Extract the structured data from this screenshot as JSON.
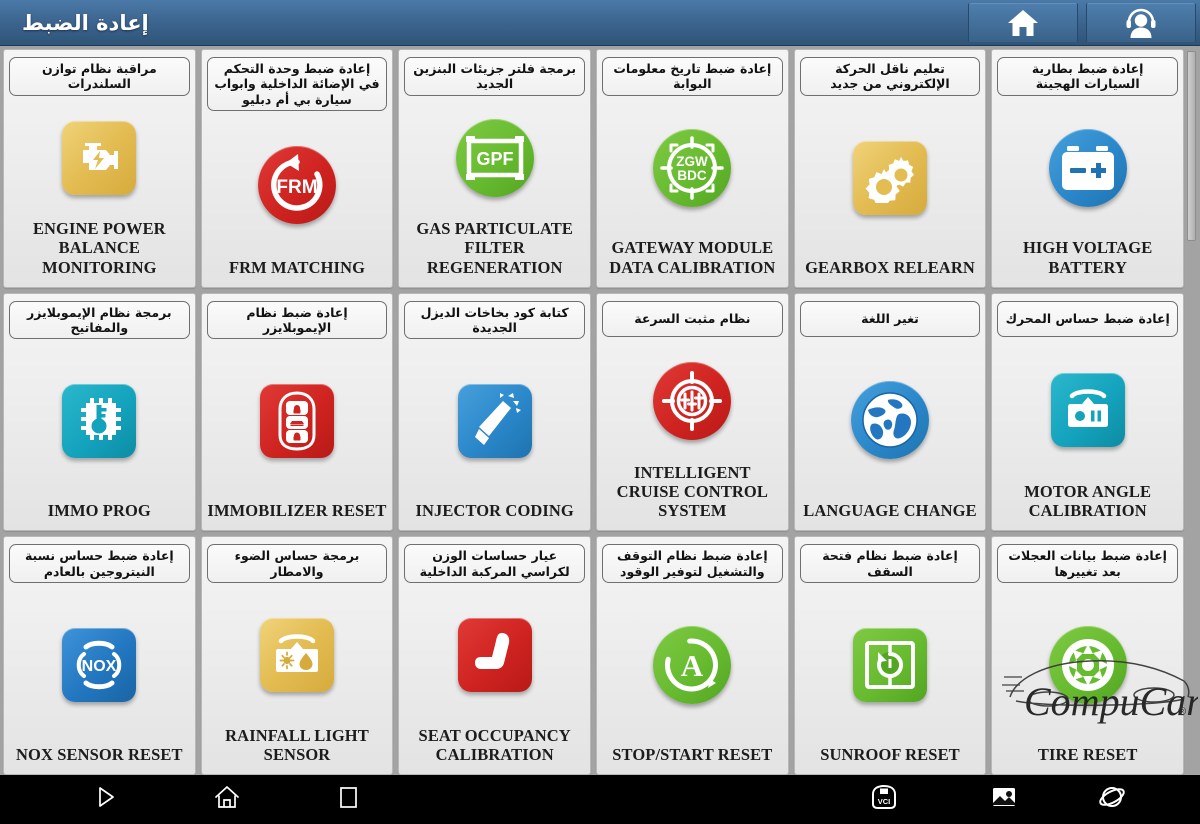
{
  "header": {
    "title": "إعادة الضبط",
    "buttons": [
      {
        "name": "home-button",
        "icon": "home-icon"
      },
      {
        "name": "support-button",
        "icon": "headset-person-icon"
      }
    ]
  },
  "grid": {
    "columns": 6,
    "rows": 3,
    "tiles": [
      {
        "arabic": "مراقبة نظام توازن السلندرات",
        "label": "ENGINE POWER BALANCE MONITORING",
        "icon": "engine-check-icon",
        "shape": "square",
        "color": "#e3bc52"
      },
      {
        "arabic": "إعادة ضبط وحدة التحكم في الإضائة الداخلية وابواب سيارة بي أم دبليو",
        "label": "FRM MATCHING",
        "icon": "frm-refresh-icon",
        "shape": "circle",
        "color": "#cf2320"
      },
      {
        "arabic": "برمجة فلتر جزيئات البنزين الجديد",
        "label": "GAS PARTICULATE FILTER REGENERATION",
        "icon": "gpf-filter-icon",
        "shape": "circle",
        "color": "#67bb2f"
      },
      {
        "arabic": "إعادة ضبط تاريخ معلومات البوابة",
        "label": "GATEWAY MODULE DATA CALIBRATION",
        "icon": "zgw-bdc-target-icon",
        "shape": "circle",
        "color": "#67bb2f"
      },
      {
        "arabic": "تعليم ناقل الحركة الإلكتروني من جديد",
        "label": "GEARBOX RELEARN",
        "icon": "gears-icon",
        "shape": "square",
        "color": "#e3bc52"
      },
      {
        "arabic": "إعادة ضبط بطارية السيارات الهجينة",
        "label": "HIGH VOLTAGE BATTERY",
        "icon": "battery-icon",
        "shape": "circle",
        "color": "#2a87c9"
      },
      {
        "arabic": "برمجة نظام الإيموبلايزر والمفاتيح",
        "label": "IMMO PROG",
        "icon": "chip-key-icon",
        "shape": "square",
        "color": "#14a3bd"
      },
      {
        "arabic": "إعادة ضبط نظام الإيموبلايزر",
        "label": "IMMOBILIZER RESET",
        "icon": "key-fob-icon",
        "shape": "square",
        "color": "#cf2320"
      },
      {
        "arabic": "كتابة كود بخاخات الديزل الجديدة",
        "label": "INJECTOR CODING",
        "icon": "injector-icon",
        "shape": "square",
        "color": "#2a87c9"
      },
      {
        "arabic": "نظام مثبت السرعة",
        "label": "INTELLIGENT CRUISE CONTROL SYSTEM",
        "icon": "cruise-target-icon",
        "shape": "circle",
        "color": "#cf2320"
      },
      {
        "arabic": "تغير اللغة",
        "label": "LANGUAGE CHANGE",
        "icon": "globe-icon",
        "shape": "circle",
        "color": "#2a87c9"
      },
      {
        "arabic": "إعادة ضبط حساس المحرك",
        "label": "MOTOR ANGLE CALIBRATION",
        "icon": "motor-sensor-icon",
        "shape": "square",
        "color": "#14a3bd"
      },
      {
        "arabic": "إعادة ضبط حساس نسبة النيتروجين بالعادم",
        "label": "NOX SENSOR RESET",
        "icon": "nox-icon",
        "shape": "square",
        "color": "#2277c0"
      },
      {
        "arabic": "برمجة حساس الضوء والامطار",
        "label": "RAINFALL LIGHT SENSOR",
        "icon": "rain-light-sensor-icon",
        "shape": "square",
        "color": "#e3bc52"
      },
      {
        "arabic": "عيار حساسات الوزن لكراسي المركبة الداخلية",
        "label": "SEAT OCCUPANCY CALIBRATION",
        "icon": "car-seat-icon",
        "shape": "square",
        "color": "#cf2320"
      },
      {
        "arabic": "إعادة ضبط نظام التوقف والتشغيل لتوفير الوقود",
        "label": "STOP/START RESET",
        "icon": "auto-start-stop-icon",
        "shape": "circle",
        "color": "#67bb2f"
      },
      {
        "arabic": "إعادة ضبط نظام فتحة السقف",
        "label": "SUNROOF RESET",
        "icon": "sunroof-reset-icon",
        "shape": "square",
        "color": "#67bb2f"
      },
      {
        "arabic": "إعادة ضبط بيانات العجلات بعد تغييرها",
        "label": "TIRE RESET",
        "icon": "tire-icon",
        "shape": "circle",
        "color": "#67bb2f"
      }
    ]
  },
  "watermark": {
    "text": "CompuCar",
    "registered": "®"
  },
  "navbar": {
    "buttons": [
      {
        "name": "back-button",
        "icon": "play-triangle-icon"
      },
      {
        "name": "home-button",
        "icon": "home-outline-icon"
      },
      {
        "name": "recents-button",
        "icon": "square-outline-icon"
      },
      {
        "name": "vci-button",
        "icon": "vci-connector-icon",
        "text": "VCI"
      },
      {
        "name": "screenshot-button",
        "icon": "image-icon"
      },
      {
        "name": "browser-button",
        "icon": "planet-icon"
      }
    ]
  }
}
